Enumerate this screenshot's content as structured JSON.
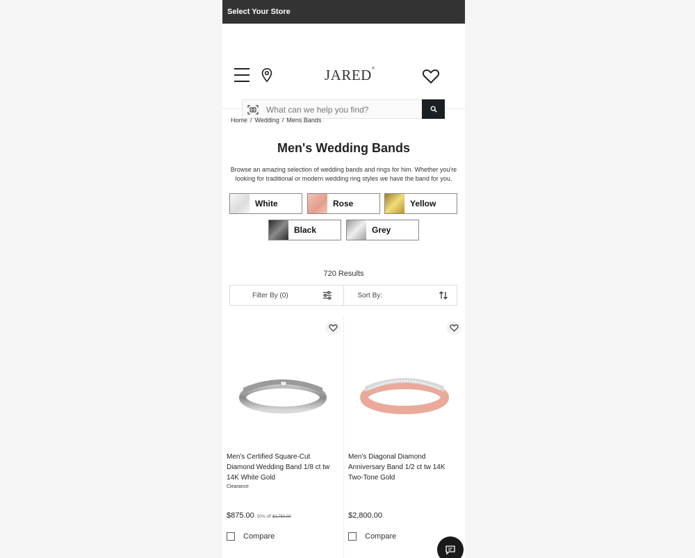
{
  "topbar": {
    "store_label": "Select Your Store"
  },
  "header": {
    "logo": "JARED",
    "logo_mark": "®",
    "search": {
      "placeholder": "What can we help you find?"
    }
  },
  "breadcrumb": [
    "Home",
    "Wedding",
    "Mens Bands"
  ],
  "breadcrumb_sep": "/",
  "page": {
    "title": "Men's Wedding Bands",
    "description": "Browse an amazing selection of wedding bands and rings for him. Whether you're looking for traditional or modern wedding ring styles we have the band for you."
  },
  "metal_swatches": [
    {
      "label": "White",
      "color": "#e8e8e8"
    },
    {
      "label": "Rose",
      "color": "#e9a99b"
    },
    {
      "label": "Yellow",
      "color": "#d4b24a"
    },
    {
      "label": "Black",
      "color": "#4a4a4a"
    },
    {
      "label": "Grey",
      "color": "#b8b8b8"
    }
  ],
  "results": {
    "count_label": "720 Results"
  },
  "toolbar": {
    "filter_label": "Filter By (0)",
    "sort_label": "Sort By:"
  },
  "products": [
    {
      "name": "Men's Certified Square-Cut Diamond Wedding Band 1/8 ct tw 14K White Gold",
      "badge": "Clearance",
      "price": "$875.00",
      "original_prefix": "50% off",
      "original_price": "$1,750.00",
      "compare_label": "Compare"
    },
    {
      "name": "Men's Diagonal Diamond Anniversary Band 1/2 ct tw 14K Two-Tone Gold",
      "badge": "",
      "price": "$2,800.00",
      "compare_label": "Compare"
    }
  ],
  "colors": {
    "topbar": "#333333",
    "search_button": "#1a1f24",
    "chat_button": "#1a1a1a"
  }
}
